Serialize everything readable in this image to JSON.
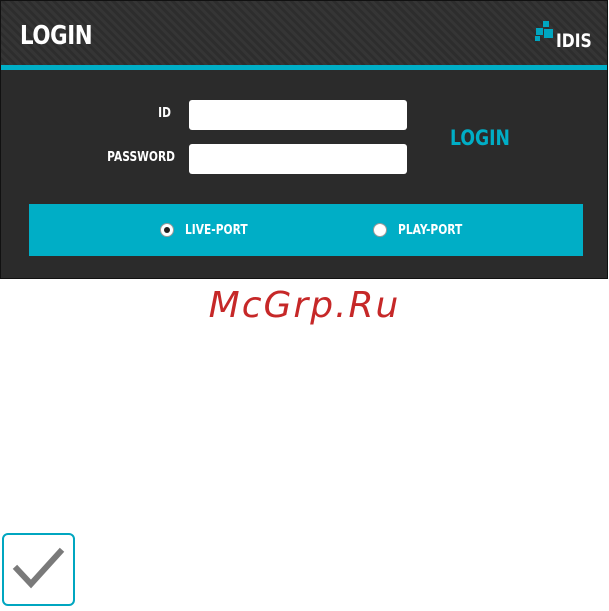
{
  "header": {
    "title": "LOGIN",
    "logo_text": "IDIS"
  },
  "form": {
    "id_label": "ID",
    "id_value": "",
    "password_label": "PASSWORD",
    "password_value": "",
    "login_button": "LOGIN"
  },
  "port_options": [
    {
      "label": "LIVE-PORT",
      "selected": true
    },
    {
      "label": "PLAY-PORT",
      "selected": false
    }
  ],
  "watermark": "McGrp.Ru",
  "icons": {
    "logo": "idis-logo-icon",
    "check": "checkmark-icon"
  },
  "colors": {
    "accent": "#00aec6",
    "header_bg": "#2b2b2b",
    "watermark": "#c62828"
  }
}
